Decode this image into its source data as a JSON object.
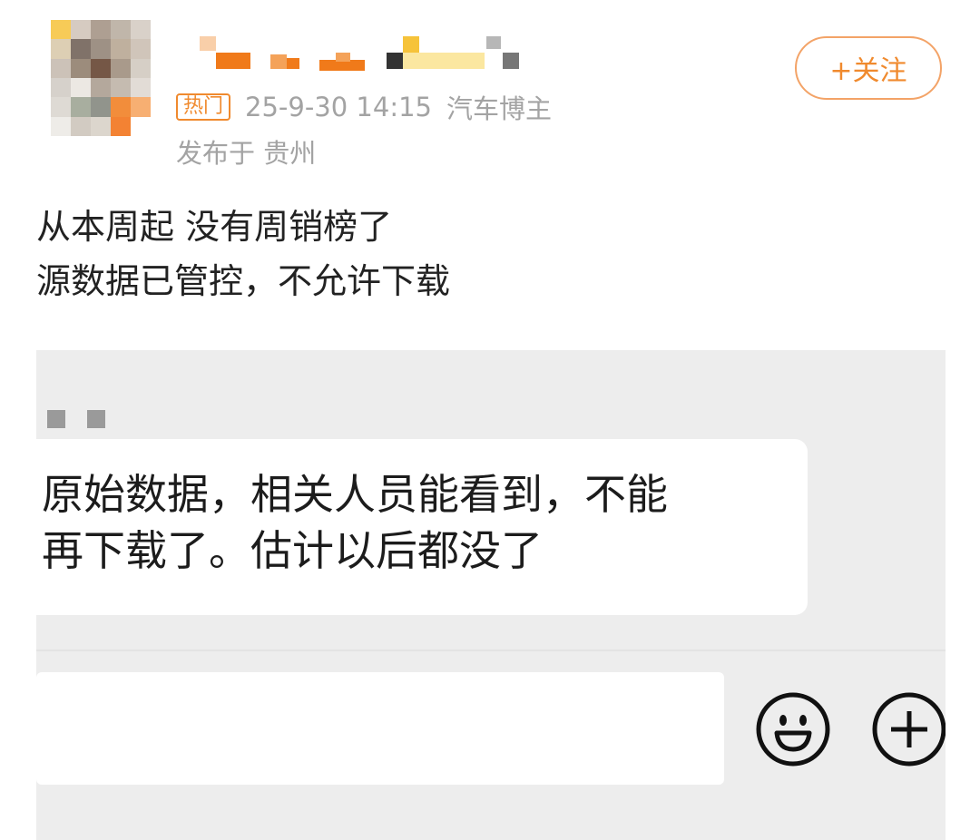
{
  "post": {
    "hot_badge": "热门",
    "date": "25-9-30 14:15",
    "role": "汽车博主",
    "location": "发布于 贵州",
    "follow_label": "+关注",
    "text_lines": [
      "从本周起 没有周销榜了",
      "源数据已管控，不允许下载"
    ]
  },
  "screenshot": {
    "message_lines": [
      "原始数据，相关人员能看到，不能",
      "再下载了。估计以后都没了"
    ]
  },
  "icons": {
    "emoji": "smiley-face-icon",
    "plus": "plus-circle-icon"
  },
  "colors": {
    "accent": "#f08a2e",
    "meta_text": "#a3a3a3",
    "chat_bg": "#ededed"
  }
}
